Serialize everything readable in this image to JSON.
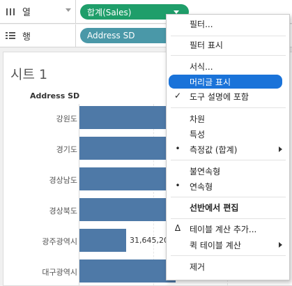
{
  "shelves": {
    "columns": {
      "label": "열",
      "pill": "합계(Sales)",
      "icon": "columns-icon"
    },
    "rows": {
      "label": "행",
      "pill": "Address SD",
      "icon": "rows-icon"
    }
  },
  "sheet": {
    "title": "시트 1",
    "column_header": "Address SD"
  },
  "chart_data": {
    "type": "bar",
    "orientation": "horizontal",
    "categories": [
      "강원도",
      "경기도",
      "경상남도",
      "경상북도",
      "광주광역시",
      "대구광역시"
    ],
    "series": [
      {
        "values": [
          null,
          null,
          null,
          null,
          31645200,
          null
        ]
      }
    ],
    "data_labels": [
      "",
      "",
      "",
      "",
      "31,645,20",
      ""
    ],
    "bar_fraction": [
      0.98,
      0.98,
      0.98,
      0.98,
      0.22,
      0.45
    ],
    "grid": true
  },
  "menu": {
    "items": [
      {
        "label": "필터...",
        "mark": "",
        "submenu": false
      },
      {
        "label": "필터 표시",
        "mark": "",
        "submenu": false
      },
      {
        "label": "서식...",
        "mark": "",
        "submenu": false
      },
      {
        "label": "머리글 표시",
        "mark": "",
        "submenu": false,
        "highlighted": true
      },
      {
        "label": "도구 설명에 포함",
        "mark": "✓",
        "submenu": false
      },
      {
        "label": "차원",
        "mark": "",
        "submenu": false
      },
      {
        "label": "특성",
        "mark": "",
        "submenu": false
      },
      {
        "label": "측정값 (합계)",
        "mark": "•",
        "submenu": true
      },
      {
        "label": "불연속형",
        "mark": "",
        "submenu": false
      },
      {
        "label": "연속형",
        "mark": "•",
        "submenu": false
      },
      {
        "label": "선반에서 편집",
        "mark": "",
        "submenu": false,
        "bold": true
      },
      {
        "label": "테이블 계산 추가...",
        "mark": "Δ",
        "submenu": false
      },
      {
        "label": "퀵 테이블 계산",
        "mark": "",
        "submenu": true
      },
      {
        "label": "제거",
        "mark": "",
        "submenu": false
      }
    ]
  },
  "colors": {
    "measure_pill": "#1f9e6a",
    "dimension_pill": "#4a98a8",
    "bar": "#4e79a7",
    "menu_highlight": "#1a73d9"
  }
}
